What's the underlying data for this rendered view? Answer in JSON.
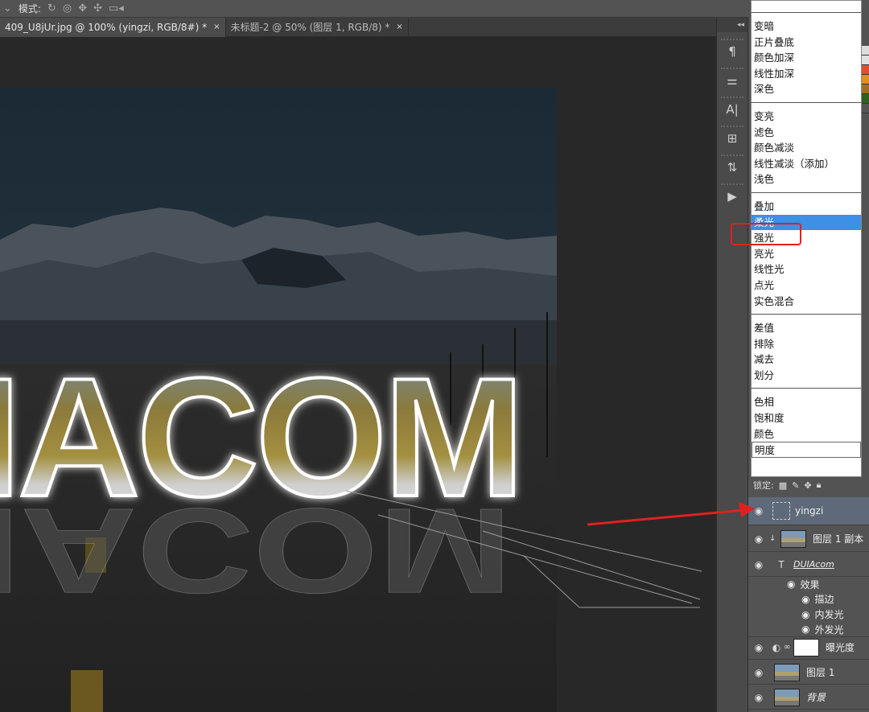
{
  "options_bar": {
    "mode_label": "模式:"
  },
  "tabs": [
    {
      "label": "409_U8jUr.jpg @ 100% (yingzi, RGB/8#) *",
      "close": "×"
    },
    {
      "label": "未标题-2 @ 50% (图层 1, RGB/8) *",
      "close": "×"
    }
  ],
  "canvas": {
    "title_text": "IACOM",
    "reflection_text": "IACOM"
  },
  "tool_strip": {
    "collapse": "◂◂",
    "buttons": [
      "¶",
      "⚌",
      "A|",
      "⊞",
      "⇅",
      "▶"
    ]
  },
  "blend_menu": {
    "groups": [
      [
        "变暗",
        "正片叠底",
        "颜色加深",
        "线性加深",
        "深色"
      ],
      [
        "变亮",
        "滤色",
        "颜色减淡",
        "线性减淡（添加）",
        "浅色"
      ],
      [
        "叠加",
        "柔光",
        "强光",
        "亮光",
        "线性光",
        "点光",
        "实色混合"
      ],
      [
        "差值",
        "排除",
        "减去",
        "划分"
      ],
      [
        "色相",
        "饱和度",
        "颜色",
        "明度"
      ]
    ],
    "selected": "柔光",
    "current": "明度"
  },
  "lock_label": "锁定:",
  "layers": {
    "items": [
      {
        "name": "yingzi"
      },
      {
        "name": "图层 1 副本"
      },
      {
        "name": "DUIAcom"
      },
      {
        "name": "效果"
      },
      {
        "name": "描边"
      },
      {
        "name": "内发光"
      },
      {
        "name": "外发光"
      },
      {
        "name": "曝光度"
      },
      {
        "name": "图层 1"
      },
      {
        "name": "背景"
      }
    ]
  },
  "colors": {
    "highlight": "#3e8fe6",
    "annotation_red": "#e02020",
    "selected_layer": "#5e6a7a"
  }
}
